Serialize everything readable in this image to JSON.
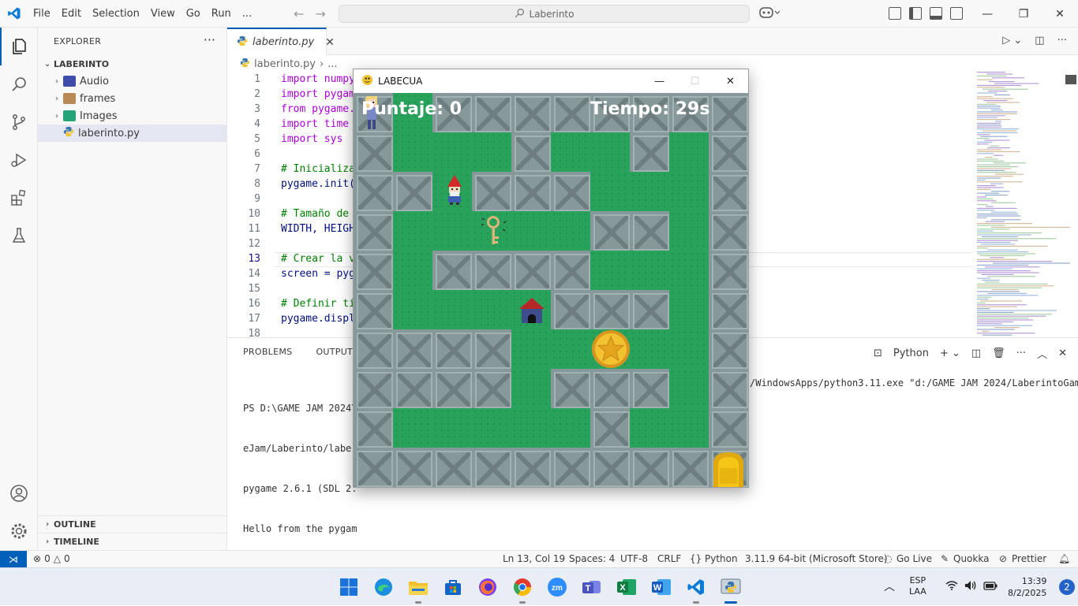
{
  "titlebar": {
    "menu": [
      "File",
      "Edit",
      "Selection",
      "View",
      "Go",
      "Run",
      "..."
    ],
    "search_text": "Laberinto"
  },
  "sidebar": {
    "title": "EXPLORER",
    "folder": "LABERINTO",
    "items": [
      {
        "label": "Audio",
        "type": "folder"
      },
      {
        "label": "frames",
        "type": "folder"
      },
      {
        "label": "Images",
        "type": "folder"
      },
      {
        "label": "laberinto.py",
        "type": "file"
      }
    ],
    "outline": "OUTLINE",
    "timeline": "TIMELINE"
  },
  "editor": {
    "tab_label": "laberinto.py",
    "breadcrumb_file": "laberinto.py",
    "breadcrumb_more": "...",
    "line_numbers": [
      "1",
      "2",
      "3",
      "4",
      "5",
      "6",
      "7",
      "8",
      "9",
      "10",
      "11",
      "12",
      "13",
      "14",
      "15",
      "16",
      "17",
      "18"
    ],
    "lines": [
      "import numpy",
      "import pygam",
      "from pygame.",
      "import time",
      "import sys",
      "",
      "# Inicializa",
      "pygame.init(",
      "",
      "# Tamaño de",
      "WIDTH, HEIGH",
      "",
      "# Crear la v",
      "screen = pyg",
      "",
      "# Definir tí",
      "pygame.displ",
      ""
    ]
  },
  "panel": {
    "tabs": [
      "PROBLEMS",
      "OUTPUT"
    ],
    "terminal_profile": "Python",
    "terminal_lines": [
      "PS D:\\GAME JAM 2024\\",
      "eJam/Laberinto/laber",
      "pygame 2.6.1 (SDL 2.",
      "Hello from the pygam"
    ],
    "terminal_right_1": "/WindowsApps/python3.11.exe \"d:/GAME JAM 2024/LaberintoGam"
  },
  "statusbar": {
    "errors": "0",
    "warnings": "0",
    "position": "Ln 13, Col 19",
    "spaces": "Spaces: 4",
    "encoding": "UTF-8",
    "eol": "CRLF",
    "language": "Python",
    "interpreter": "3.11.9 64-bit (Microsoft Store)",
    "go_live": "Go Live",
    "quokka": "Quokka",
    "prettier": "Prettier"
  },
  "game": {
    "window_title": "LABECUA",
    "score_text": "Puntaje: 0",
    "time_text": "Tiempo: 29s"
  },
  "taskbar": {
    "lang_1": "ESP",
    "lang_2": "LAA",
    "time": "13:39",
    "date": "8/2/2025",
    "notifications": "2"
  },
  "colors": {
    "accent": "#005fb8",
    "grass": "#29a25b",
    "wall": "#87989a"
  }
}
